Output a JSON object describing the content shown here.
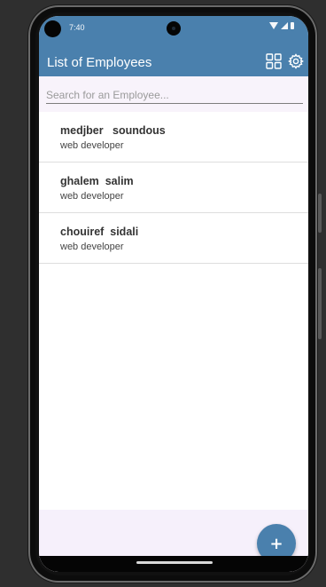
{
  "status_bar": {
    "time": "7:40"
  },
  "app_bar": {
    "title": "List of Employees",
    "grid_icon": "grid-view-icon",
    "settings_icon": "gear-icon",
    "color": "#4a80ad"
  },
  "search": {
    "placeholder": "Search for an Employee...",
    "value": ""
  },
  "employees": [
    {
      "name": "medjber   soundous",
      "role": "web developer"
    },
    {
      "name": "ghalem  salim",
      "role": "web developer"
    },
    {
      "name": "chouiref  sidali",
      "role": "web developer"
    }
  ],
  "fab": {
    "label": "+",
    "icon": "add-icon"
  }
}
